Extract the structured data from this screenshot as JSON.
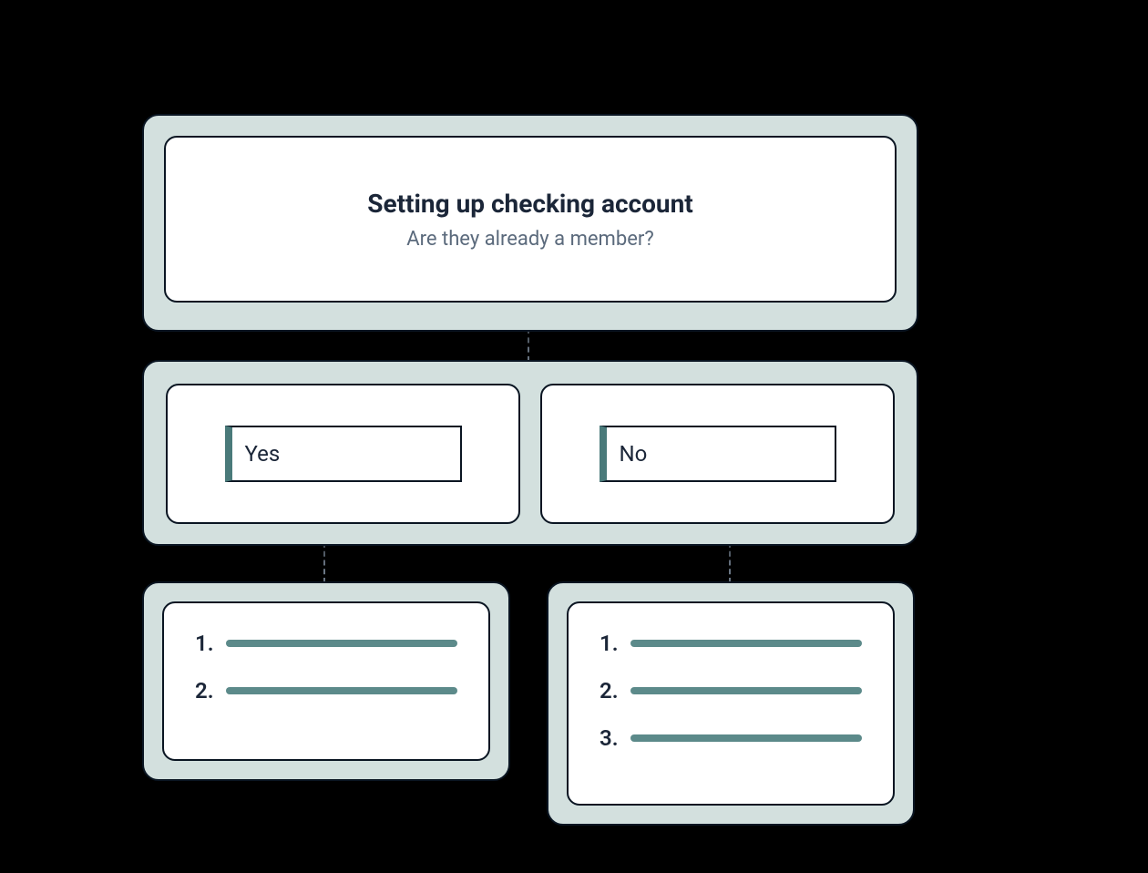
{
  "header": {
    "title": "Setting up checking account",
    "subtitle": "Are they already a member?"
  },
  "choices": {
    "yes": "Yes",
    "no": "No"
  },
  "leftList": {
    "count": 2,
    "n1": "1.",
    "n2": "2."
  },
  "rightList": {
    "count": 3,
    "n1": "1.",
    "n2": "2.",
    "n3": "3."
  },
  "colors": {
    "panel": "#d3e0de",
    "bar": "#5c8a8a",
    "accent": "#4a7a7a"
  }
}
